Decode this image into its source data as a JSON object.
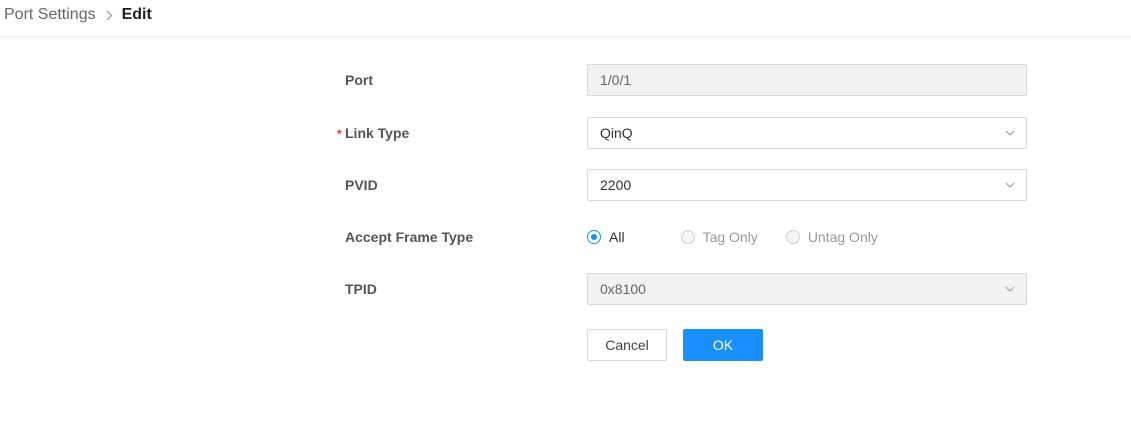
{
  "breadcrumb": {
    "parent": "Port Settings",
    "current": "Edit"
  },
  "form": {
    "port": {
      "label": "Port",
      "value": "1/0/1"
    },
    "link_type": {
      "required_mark": "*",
      "label": "Link Type",
      "value": "QinQ"
    },
    "pvid": {
      "label": "PVID",
      "value": "2200"
    },
    "accept_frame_type": {
      "label": "Accept Frame Type",
      "options": [
        {
          "label": "All",
          "selected": true
        },
        {
          "label": "Tag Only",
          "selected": false
        },
        {
          "label": "Untag Only",
          "selected": false
        }
      ]
    },
    "tpid": {
      "label": "TPID",
      "value": "0x8100"
    }
  },
  "actions": {
    "cancel_label": "Cancel",
    "ok_label": "OK"
  },
  "colors": {
    "primary": "#1890ff",
    "required": "#e53935"
  }
}
